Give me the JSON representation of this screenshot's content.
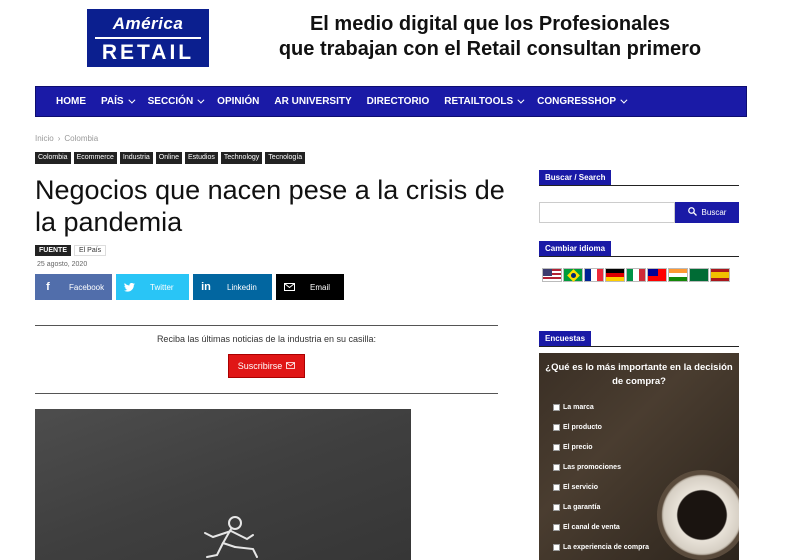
{
  "header": {
    "logo_top": "América",
    "logo_bottom": "RETAIL",
    "tagline_line1": "El medio digital que los Profesionales",
    "tagline_line2": "que trabajan con el Retail consultan primero"
  },
  "nav": {
    "items": [
      {
        "label": "HOME",
        "dropdown": false
      },
      {
        "label": "PAÍS",
        "dropdown": true
      },
      {
        "label": "SECCIÓN",
        "dropdown": true
      },
      {
        "label": "OPINIÓN",
        "dropdown": false
      },
      {
        "label": "AR UNIVERSITY",
        "dropdown": false
      },
      {
        "label": "DIRECTORIO",
        "dropdown": false
      },
      {
        "label": "RETAILTOOLS",
        "dropdown": true
      },
      {
        "label": "CONGRESSHOP",
        "dropdown": true
      }
    ]
  },
  "breadcrumb": {
    "home": "Inicio",
    "sep": "›",
    "current": "Colombia"
  },
  "tags": [
    "Colombia",
    "Ecommerce",
    "Industria",
    "Online",
    "Estudios",
    "Technology",
    "Tecnología"
  ],
  "article": {
    "title": "Negocios que nacen pese a la crisis de la pandemia",
    "source_label": "FUENTE",
    "source_name": "El País",
    "date": "25 agosto, 2020"
  },
  "share": {
    "facebook": "Facebook",
    "twitter": "Twitter",
    "linkedin": "Linkedin",
    "email": "Email"
  },
  "newsletter": {
    "text": "Reciba las últimas noticias de la industria en su casilla:",
    "button": "Suscribirse"
  },
  "sidebar": {
    "search_title": "Buscar / Search",
    "search_button": "Buscar",
    "language_title": "Cambiar idioma",
    "polls_title": "Encuestas",
    "poll_question": "¿Qué es lo más importante en la decisión de compra?",
    "poll_options": [
      "La marca",
      "El producto",
      "El precio",
      "Las promociones",
      "El servicio",
      "La garantía",
      "El canal de venta",
      "La experiencia de compra"
    ]
  },
  "colors": {
    "nav_blue": "#1a1aa6",
    "subscribe_red": "#e01616"
  }
}
